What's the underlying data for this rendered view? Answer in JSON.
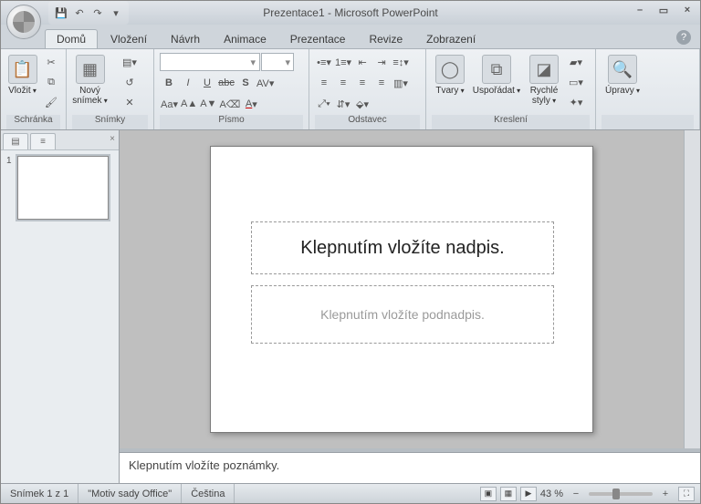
{
  "title": "Prezentace1 - Microsoft PowerPoint",
  "qat": {
    "save": "💾",
    "undo": "↶",
    "redo": "↷",
    "more": "▾"
  },
  "tabs": [
    "Domů",
    "Vložení",
    "Návrh",
    "Animace",
    "Prezentace",
    "Revize",
    "Zobrazení"
  ],
  "active_tab": 0,
  "ribbon": {
    "clipboard": {
      "label": "Schránka",
      "paste": "Vložit"
    },
    "slides": {
      "label": "Snímky",
      "new_slide": "Nový\nsnímek"
    },
    "font": {
      "label": "Písmo",
      "name": "",
      "size": ""
    },
    "paragraph": {
      "label": "Odstavec"
    },
    "drawing": {
      "label": "Kreslení",
      "shapes": "Tvary",
      "arrange": "Uspořádat",
      "quick": "Rychlé\nstyly"
    },
    "editing": {
      "label": "Úpravy"
    }
  },
  "nav": {
    "slide_number": "1"
  },
  "slide": {
    "title_placeholder": "Klepnutím vložíte nadpis.",
    "subtitle_placeholder": "Klepnutím vložíte podnadpis."
  },
  "notes_placeholder": "Klepnutím vložíte poznámky.",
  "status": {
    "slide_info": "Snímek 1 z 1",
    "theme": "\"Motiv sady Office\"",
    "language": "Čeština",
    "zoom": "43 %"
  }
}
